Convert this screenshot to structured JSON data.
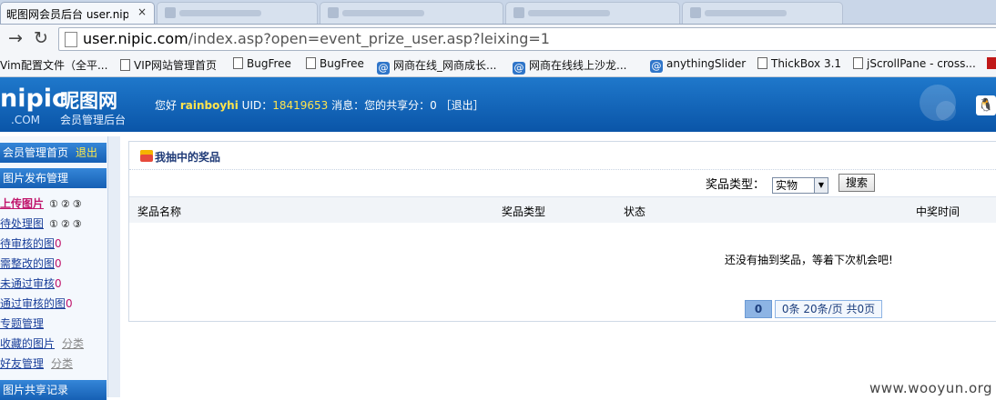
{
  "browser": {
    "active_tab_title": "昵图网会员后台 user.nipic",
    "tab_close": "×",
    "url_host": "user.nipic.com",
    "url_rest": "/index.asp?open=event_prize_user.asp?leixing=1",
    "bookmarks": [
      {
        "label": "Vim配置文件（全平...",
        "icon": "page-icon"
      },
      {
        "label": "VIP网站管理首页",
        "icon": "page-icon"
      },
      {
        "label": "BugFree",
        "icon": "page-icon"
      },
      {
        "label": "BugFree",
        "icon": "page-icon"
      },
      {
        "label": "网商在线_网商成长...",
        "icon": "at-icon"
      },
      {
        "label": "网商在线线上沙龙...",
        "icon": "at-icon"
      },
      {
        "label": "anythingSlider",
        "icon": "at-icon"
      },
      {
        "label": "ThickBox 3.1",
        "icon": "page-icon"
      },
      {
        "label": "jScrollPane - cross...",
        "icon": "page-icon"
      }
    ]
  },
  "header": {
    "logo_en": "nipic",
    "logo_com": ".COM",
    "logo_cn": "昵图网",
    "logo_sub": "会员管理后台",
    "greeting": "您好",
    "username": "rainboyhi",
    "uid_label": "UID：",
    "uid": "18419653",
    "msg_label": "消息：",
    "share_text": "您的共享分：0",
    "logout": "［退出］"
  },
  "sidebar": {
    "home": "会员管理首页",
    "logout": "退出",
    "section1": "图片发布管理",
    "items": [
      {
        "label": "上传图片",
        "num": "①②③"
      },
      {
        "label": "待处理图",
        "num": "①②③"
      },
      {
        "label": "待审核的图",
        "count": "0"
      },
      {
        "label": "需整改的图",
        "count": "0"
      },
      {
        "label": "未通过审核",
        "count": "0"
      },
      {
        "label": "通过审核的图",
        "count": "0"
      },
      {
        "label": "专题管理"
      },
      {
        "label": "收藏的图片",
        "sub": "分类"
      },
      {
        "label": "好友管理",
        "sub": "分类"
      }
    ],
    "section2": "图片共享记录"
  },
  "main": {
    "title": "我抽中的奖品",
    "filter_label": "奖品类型：",
    "filter_value": "实物",
    "search_button": "搜索",
    "columns": [
      "奖品名称",
      "奖品类型",
      "状态",
      "中奖时间"
    ],
    "empty_message": "还没有抽到奖品，等着下次机会吧!",
    "pager_current": "0",
    "pager_info": "0条 20条/页 共0页"
  },
  "watermark": "www.wooyun.org"
}
